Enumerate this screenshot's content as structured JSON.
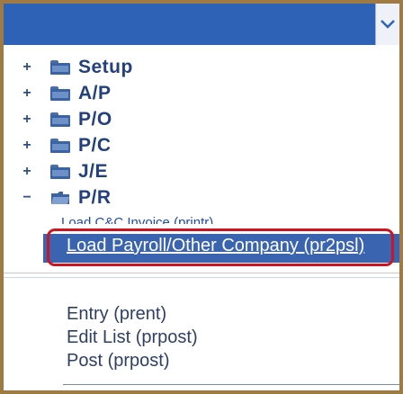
{
  "tree": {
    "items": [
      {
        "expander": "+",
        "label": "Setup",
        "icon": "folder-icon"
      },
      {
        "expander": "+",
        "label": "A/P",
        "icon": "folder-icon"
      },
      {
        "expander": "+",
        "label": "P/O",
        "icon": "folder-icon"
      },
      {
        "expander": "+",
        "label": "P/C",
        "icon": "folder-icon"
      },
      {
        "expander": "+",
        "label": "J/E",
        "icon": "folder-icon"
      },
      {
        "expander": "−",
        "label": "P/R",
        "icon": "open-folder-icon"
      }
    ],
    "cut_item": "Load C&C Invoice (printr)",
    "highlighted_item": "Load Payroll/Other Company (pr2psl)"
  },
  "menu": {
    "items": [
      "Entry (prent)",
      "Edit List (prpost)",
      "Post (prpost)"
    ]
  },
  "colors": {
    "accent": "#2d62b6",
    "highlight": "#3b64b0",
    "callout": "#cc1522",
    "frame": "#a07a45"
  }
}
